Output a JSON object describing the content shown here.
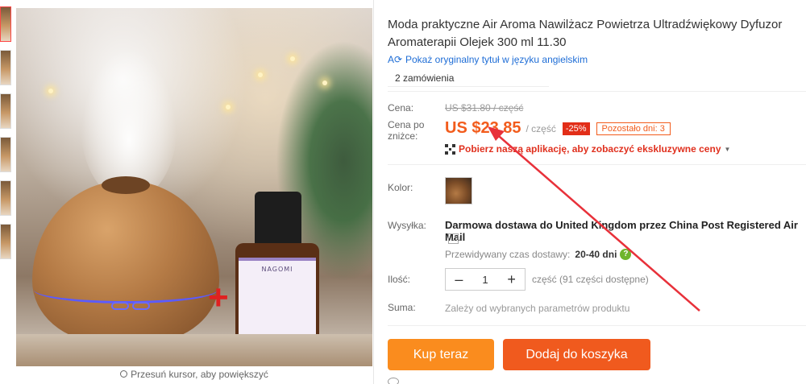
{
  "title": "Moda praktyczne Air Aroma Nawilżacz Powietrza Ultradźwiękowy Dyfuzor Aromaterapii Olejek 300 ml 11.30",
  "original_title_link": "Pokaż oryginalny tytuł w języku angielskim",
  "orders": "2 zamówienia",
  "price_label": "Cena:",
  "original_price": "US $31.80 / część",
  "discount_price_label": "Cena po zniżce:",
  "price": "US $23.85",
  "price_unit": "/ część",
  "discount": "-25%",
  "remaining": "Pozostało dni: 3",
  "app_promo": "Pobierz naszą aplikację, aby zobaczyć ekskluzywne ceny",
  "color_label": "Kolor:",
  "shipping_label": "Wysyłka:",
  "shipping_free": "Darmowa dostawa do",
  "shipping_destination": "United Kingdom przez China Post Registered Air Mail",
  "eta_label": "Przewidywany czas dostawy:",
  "eta_value": "20-40 dni",
  "quantity_label": "Ilość:",
  "quantity_value": "1",
  "stock": "część (91 części dostępne)",
  "sum_label": "Suma:",
  "sum_text": "Zależy od wybranych parametrów produktu",
  "buy_now": "Kup teraz",
  "add_to_cart": "Dodaj do koszyka",
  "zoom_hint": "Przesuń kursor, aby powiększyć",
  "bottle_brand": "NAGOMI",
  "colors": {
    "price": "#f25c1c",
    "discount_bg": "#e22e18",
    "buy": "#fa8c1e",
    "cart": "#f05a1e",
    "link": "#1e6dd6",
    "arrow": "#e8313a"
  }
}
